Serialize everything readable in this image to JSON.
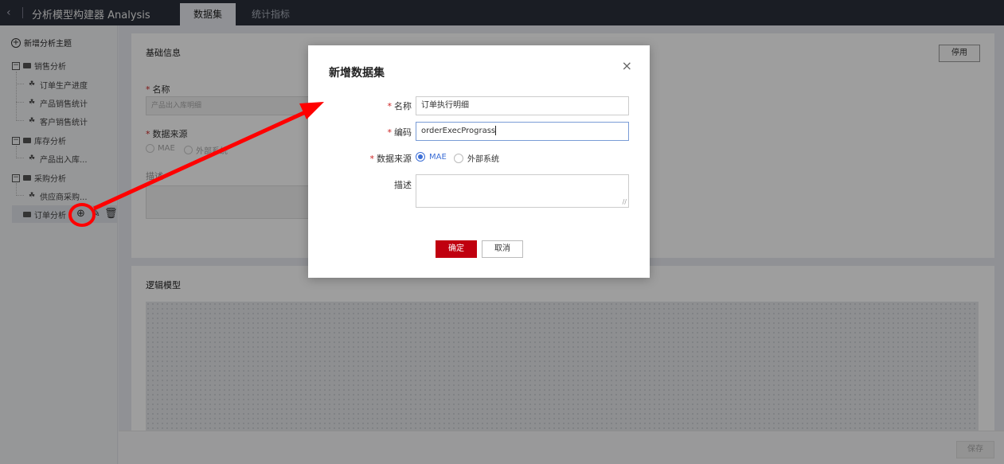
{
  "app": {
    "back_icon": "chevron-left-icon",
    "title": "分析模型构建器 Analysis",
    "tabs": [
      {
        "label": "数据集"
      },
      {
        "label": "统计指标"
      }
    ]
  },
  "sidebar": {
    "new_topic": "新增分析主题",
    "groups": [
      {
        "label": "销售分析",
        "items": [
          "订单生产进度",
          "产品销售统计",
          "客户销售统计"
        ]
      },
      {
        "label": "库存分析",
        "items": [
          "产品出入库..."
        ]
      },
      {
        "label": "采购分析",
        "items": [
          "供应商采购..."
        ]
      },
      {
        "label": "订单分析",
        "items": []
      }
    ],
    "selected_actions": [
      "add-circle-icon",
      "edit-icon",
      "trash-icon"
    ]
  },
  "main": {
    "basic_info_title": "基础信息",
    "disable_button": "停用",
    "name_label": "名称",
    "name_value": "产品出入库明细",
    "source_label": "数据来源",
    "source_options": [
      "MAE",
      "外部系统"
    ],
    "desc_label": "描述",
    "logic_model_title": "逻辑模型",
    "save_button": "保存"
  },
  "dialog": {
    "title": "新增数据集",
    "close_icon": "close-icon",
    "name_label": "名称",
    "name_value": "订单执行明细",
    "code_label": "编码",
    "code_value": "orderExecPrograss",
    "source_label": "数据来源",
    "source_options": [
      {
        "label": "MAE",
        "selected": true
      },
      {
        "label": "外部系统",
        "selected": false
      }
    ],
    "desc_label": "描述",
    "desc_value": "",
    "ok_button": "确定",
    "cancel_button": "取消"
  },
  "colors": {
    "topbar": "#2b303b",
    "primary_red": "#c0000f",
    "radio_blue": "#3d6fd6",
    "annotation_red": "#ff0000"
  }
}
